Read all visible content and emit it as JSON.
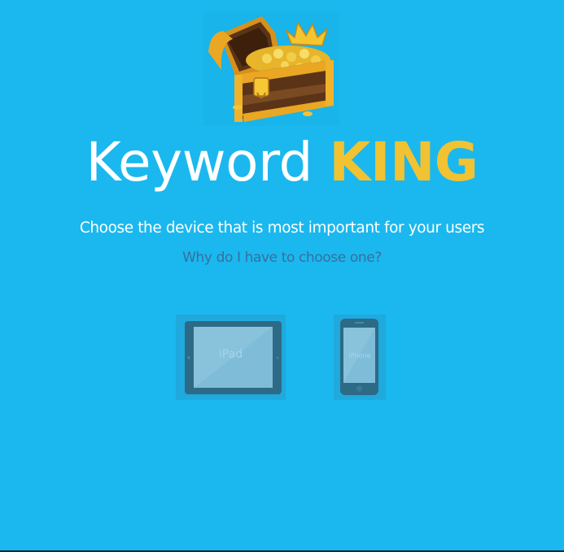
{
  "brand": {
    "title_part1": "Keyword",
    "title_part2": "KING"
  },
  "prompt": {
    "heading": "Choose the device that is most important for your users",
    "help_link": "Why do I have to choose one?"
  },
  "devices": [
    {
      "label": "iPad"
    },
    {
      "label": "iPhone"
    }
  ],
  "colors": {
    "background": "#1ab8ee",
    "title_accent": "#f1c232",
    "help_link": "#3a6e9e",
    "device_body": "#2d6a86"
  },
  "icons": {
    "logo": "treasure-chest-icon",
    "ipad": "ipad-icon",
    "iphone": "iphone-icon"
  }
}
